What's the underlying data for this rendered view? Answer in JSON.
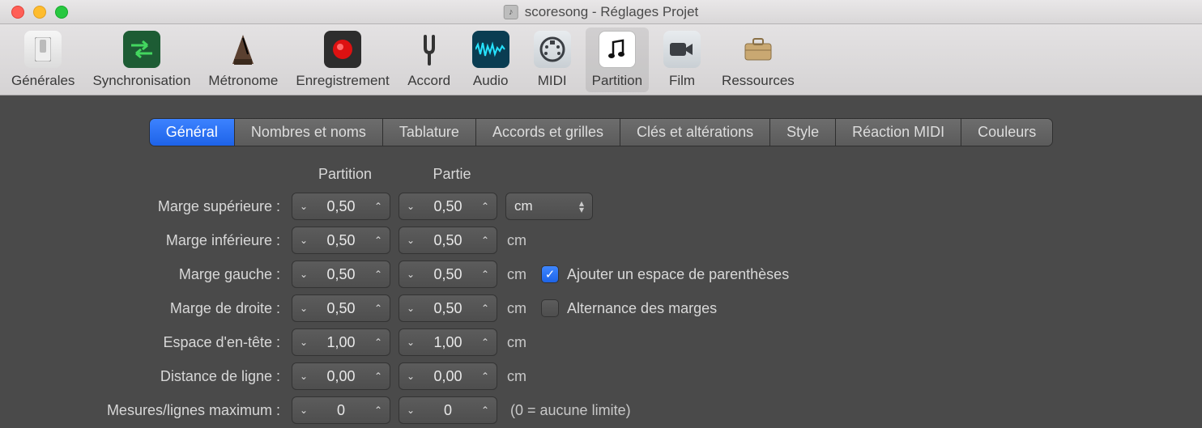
{
  "window": {
    "title": "scoresong - Réglages Projet"
  },
  "toolbar": {
    "items": [
      {
        "id": "general",
        "label": "Générales"
      },
      {
        "id": "sync",
        "label": "Synchronisation"
      },
      {
        "id": "metronome",
        "label": "Métronome"
      },
      {
        "id": "record",
        "label": "Enregistrement"
      },
      {
        "id": "tuning",
        "label": "Accord"
      },
      {
        "id": "audio",
        "label": "Audio"
      },
      {
        "id": "midi",
        "label": "MIDI"
      },
      {
        "id": "score",
        "label": "Partition",
        "selected": true
      },
      {
        "id": "movie",
        "label": "Film"
      },
      {
        "id": "assets",
        "label": "Ressources"
      }
    ]
  },
  "subtabs": {
    "items": [
      {
        "id": "general",
        "label": "Général",
        "active": true
      },
      {
        "id": "numbers",
        "label": "Nombres et noms"
      },
      {
        "id": "tab",
        "label": "Tablature"
      },
      {
        "id": "chords",
        "label": "Accords et grilles"
      },
      {
        "id": "clefs",
        "label": "Clés et altérations"
      },
      {
        "id": "style",
        "label": "Style"
      },
      {
        "id": "midireact",
        "label": "Réaction MIDI"
      },
      {
        "id": "colors",
        "label": "Couleurs"
      }
    ]
  },
  "columns": {
    "partition": "Partition",
    "partie": "Partie"
  },
  "units": {
    "selected": "cm",
    "label_cm": "cm"
  },
  "rows": {
    "top_margin": {
      "label": "Marge supérieure :",
      "partition": "0,50",
      "partie": "0,50"
    },
    "bot_margin": {
      "label": "Marge inférieure :",
      "partition": "0,50",
      "partie": "0,50"
    },
    "left_margin": {
      "label": "Marge gauche :",
      "partition": "0,50",
      "partie": "0,50"
    },
    "right_margin": {
      "label": "Marge de droite :",
      "partition": "0,50",
      "partie": "0,50"
    },
    "header_space": {
      "label": "Espace d'en-tête :",
      "partition": "1,00",
      "partie": "1,00"
    },
    "line_dist": {
      "label": "Distance de ligne :",
      "partition": "0,00",
      "partie": "0,00"
    },
    "max_bars": {
      "label": "Mesures/lignes maximum :",
      "partition": "0",
      "partie": "0",
      "note": "(0 = aucune limite)"
    }
  },
  "checkboxes": {
    "add_bracket_space": {
      "label": "Ajouter un espace de parenthèses",
      "checked": true
    },
    "alternating_margins": {
      "label": "Alternance des marges",
      "checked": false
    }
  }
}
